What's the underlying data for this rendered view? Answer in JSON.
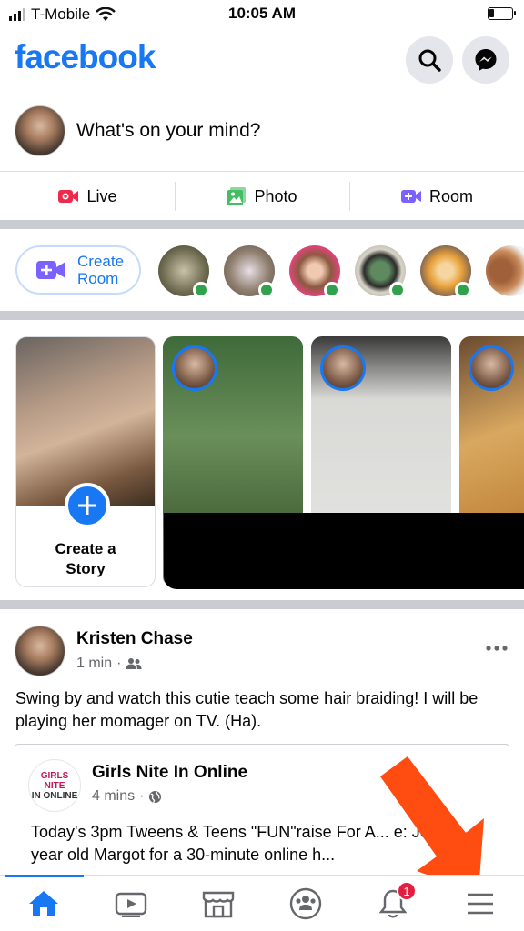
{
  "status_bar": {
    "carrier": "T-Mobile",
    "time": "10:05 AM"
  },
  "header": {
    "logo": "facebook",
    "search_icon": "search-icon",
    "messenger_icon": "messenger-icon"
  },
  "composer": {
    "prompt": "What's on your mind?"
  },
  "actions": [
    {
      "label": "Live",
      "icon": "live-video-icon",
      "color": "#f02849"
    },
    {
      "label": "Photo",
      "icon": "photo-icon",
      "color": "#45bd62"
    },
    {
      "label": "Room",
      "icon": "room-icon",
      "color": "#7b61ff"
    }
  ],
  "rooms": {
    "create_label_line1": "Create",
    "create_label_line2": "Room"
  },
  "stories": {
    "create_label_line1": "Create a",
    "create_label_line2": "Story"
  },
  "post": {
    "author": "Kristen Chase",
    "time": "1 min",
    "audience_icon": "friends-icon",
    "more_icon": "more-icon",
    "text": "Swing by and watch this cutie teach some hair braiding! I will be playing her momager on TV. (Ha).",
    "shared": {
      "logo_line1": "GIRLS NITE",
      "logo_line2": "IN ONLINE",
      "name": "Girls Nite In Online",
      "time": "4 mins",
      "audience_icon": "globe-icon",
      "text": "Today's 3pm Tweens & Teens \"FUN\"raise For A... e: Join 11-year old Margot for a 30-minute online h..."
    }
  },
  "bottom_nav": {
    "items": [
      {
        "icon": "home-icon",
        "active": true
      },
      {
        "icon": "watch-icon",
        "active": false
      },
      {
        "icon": "marketplace-icon",
        "active": false
      },
      {
        "icon": "groups-icon",
        "active": false
      },
      {
        "icon": "notifications-icon",
        "active": false,
        "badge": "1"
      },
      {
        "icon": "menu-icon",
        "active": false
      }
    ]
  },
  "colors": {
    "brand": "#1877f2",
    "annotation_arrow": "#ff4d12"
  }
}
